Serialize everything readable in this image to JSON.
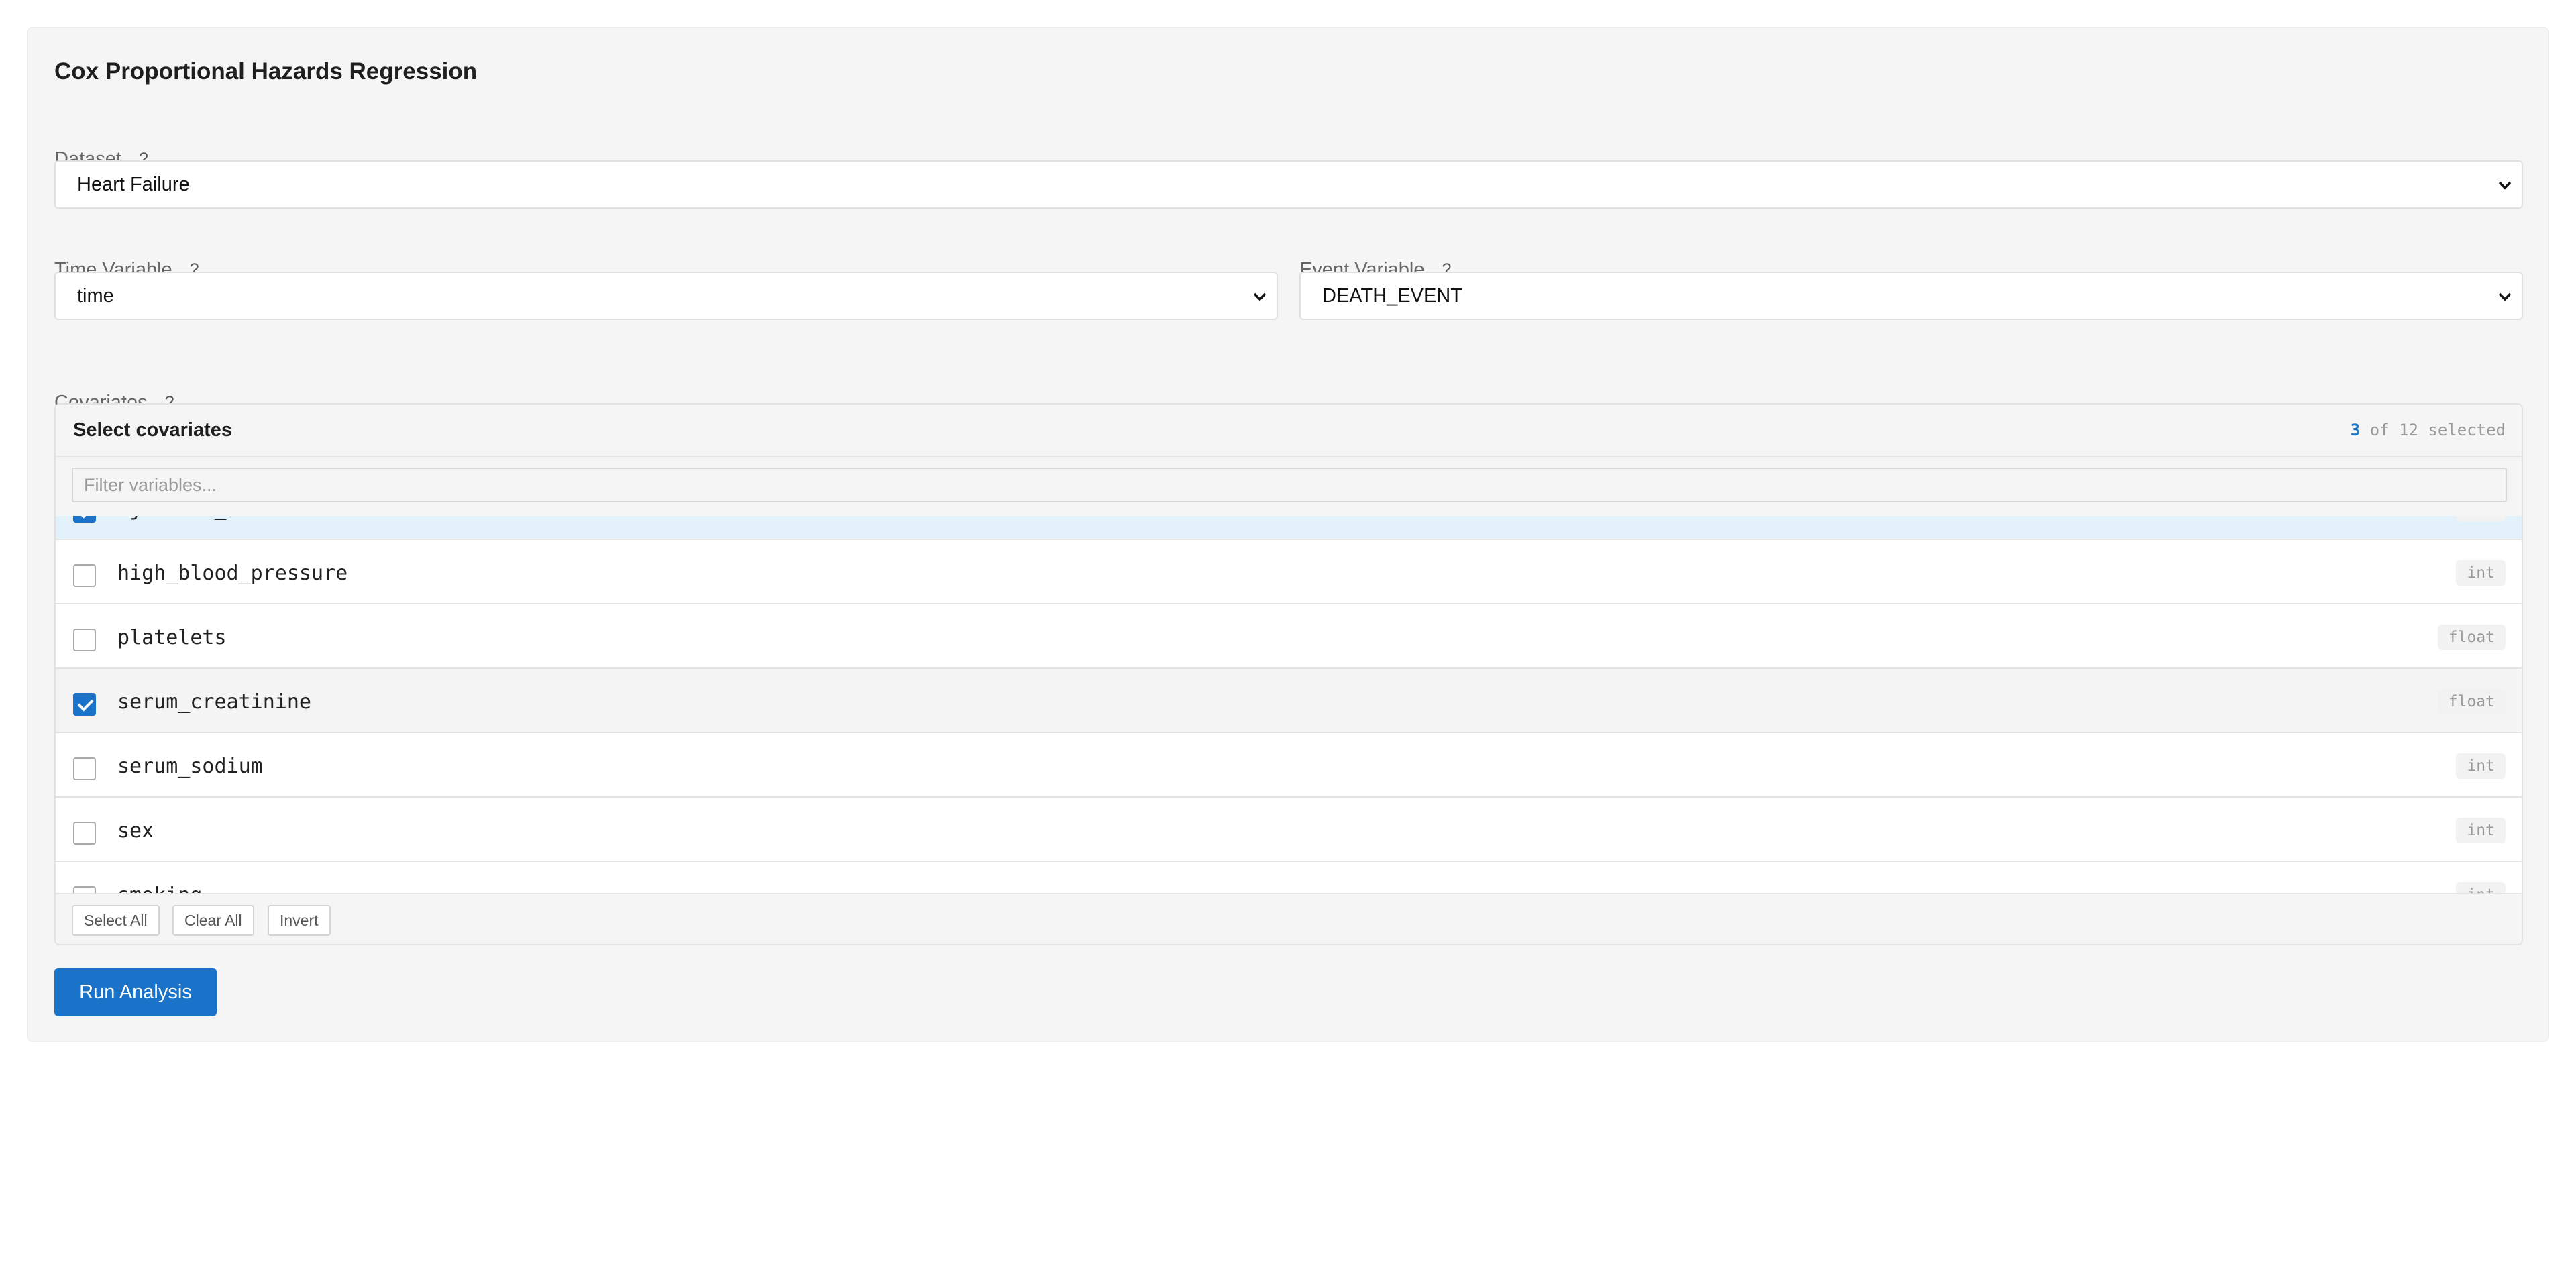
{
  "form": {
    "title": "Cox Proportional Hazards Regression",
    "help_glyph": "?",
    "dataset": {
      "label": "Dataset",
      "value": "Heart Failure"
    },
    "time_variable": {
      "label": "Time Variable",
      "value": "time"
    },
    "event_variable": {
      "label": "Event Variable",
      "value": "DEATH_EVENT"
    },
    "covariates": {
      "label": "Covariates",
      "header": "Select covariates",
      "selected_count": "3",
      "count_suffix": " of 12 selected",
      "filter_placeholder": "Filter variables...",
      "items": [
        {
          "name": "ejection_fraction",
          "type": "int",
          "checked": true
        },
        {
          "name": "high_blood_pressure",
          "type": "int",
          "checked": false
        },
        {
          "name": "platelets",
          "type": "float",
          "checked": false
        },
        {
          "name": "serum_creatinine",
          "type": "float",
          "checked": true
        },
        {
          "name": "serum_sodium",
          "type": "int",
          "checked": false
        },
        {
          "name": "sex",
          "type": "int",
          "checked": false
        },
        {
          "name": "smoking",
          "type": "int",
          "checked": false
        }
      ],
      "buttons": {
        "select_all": "Select All",
        "clear_all": "Clear All",
        "invert": "Invert"
      }
    },
    "run_button": "Run Analysis"
  },
  "colors": {
    "accent": "#1a73c8",
    "panel": "#f5f5f5",
    "row_highlight": "#e3f1fb"
  }
}
